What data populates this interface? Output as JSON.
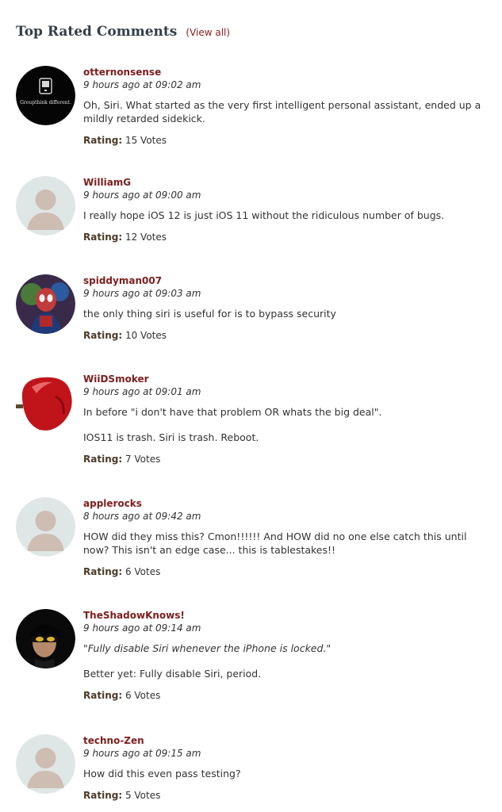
{
  "header": {
    "title": "Top Rated Comments",
    "view_all": "(View all)"
  },
  "rating_label": "Rating:",
  "comments": [
    {
      "author": "otternonsense",
      "time": "9 hours ago at 09:02 am",
      "paragraphs": [
        "Oh, Siri. What started as the very first intelligent personal assistant, ended up a mildly retarded sidekick."
      ],
      "votes": "15 Votes",
      "avatar": {
        "type": "logo",
        "text": "Groupthink different."
      }
    },
    {
      "author": "WilliamG",
      "time": "9 hours ago at 09:00 am",
      "paragraphs": [
        "I really hope iOS 12 is just iOS 11 without the ridiculous number of bugs."
      ],
      "votes": "12 Votes",
      "avatar": {
        "type": "default"
      }
    },
    {
      "author": "spiddyman007",
      "time": "9 hours ago at 09:03 am",
      "paragraphs": [
        "the only thing siri is useful for is to bypass security"
      ],
      "votes": "10 Votes",
      "avatar": {
        "type": "photo-spidey"
      }
    },
    {
      "author": "WiiDSmoker",
      "time": "9 hours ago at 09:01 am",
      "paragraphs": [
        "In before \"i don't have that problem OR whats the big deal\".",
        "IOS11 is trash. Siri is trash. Reboot."
      ],
      "votes": "7 Votes",
      "avatar": {
        "type": "apple"
      }
    },
    {
      "author": "applerocks",
      "time": "8 hours ago at 09:42 am",
      "paragraphs": [
        "HOW did they miss this? Cmon!!!!!! And HOW did no one else catch this until now? This isn't an edge case... this is tablestakes!!"
      ],
      "votes": "6 Votes",
      "avatar": {
        "type": "default"
      }
    },
    {
      "author": "TheShadowKnows!",
      "time": "9 hours ago at 09:14 am",
      "paragraphs": [
        "\"Fully disable Siri whenever the iPhone is locked.\"",
        "Better yet: Fully disable Siri, period."
      ],
      "italic_first": true,
      "votes": "6 Votes",
      "avatar": {
        "type": "photo-shadow"
      }
    },
    {
      "author": "techno-Zen",
      "time": "9 hours ago at 09:15 am",
      "paragraphs": [
        "How did this even pass testing?"
      ],
      "votes": "5 Votes",
      "avatar": {
        "type": "default"
      }
    }
  ]
}
